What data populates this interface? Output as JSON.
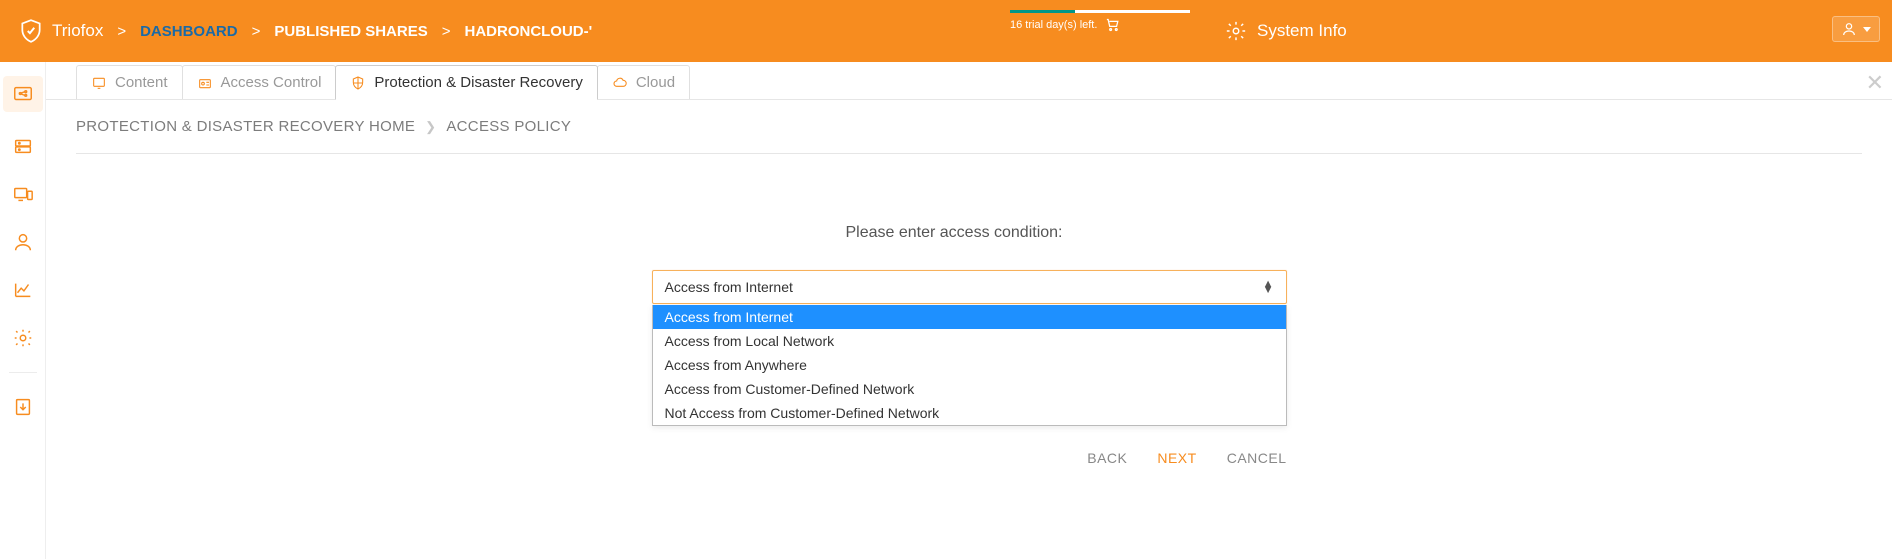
{
  "header": {
    "brand": "Triofox",
    "breadcrumb": [
      "DASHBOARD",
      "PUBLISHED SHARES",
      "HADRONCLOUD-'"
    ],
    "trial": {
      "label": "16 trial day(s) left."
    },
    "system_info": "System Info"
  },
  "sidebar": {
    "items": [
      "share",
      "servers",
      "device",
      "user",
      "chart",
      "settings",
      "download"
    ]
  },
  "tabs": [
    {
      "label": "Content"
    },
    {
      "label": "Access Control"
    },
    {
      "label": "Protection & Disaster Recovery"
    },
    {
      "label": "Cloud"
    }
  ],
  "sub_breadcrumb": [
    "PROTECTION & DISASTER RECOVERY HOME",
    "ACCESS POLICY"
  ],
  "form": {
    "prompt": "Please enter access condition:",
    "selected": "Access from Internet",
    "options": [
      "Access from Internet",
      "Access from Local Network",
      "Access from Anywhere",
      "Access from Customer-Defined Network",
      "Not Access from Customer-Defined Network"
    ]
  },
  "buttons": {
    "back": "BACK",
    "next": "NEXT",
    "cancel": "CANCEL"
  },
  "colors": {
    "brand": "#f78c1f",
    "accent": "#009688",
    "link": "#1a6aa6",
    "highlight": "#1e90ff"
  }
}
